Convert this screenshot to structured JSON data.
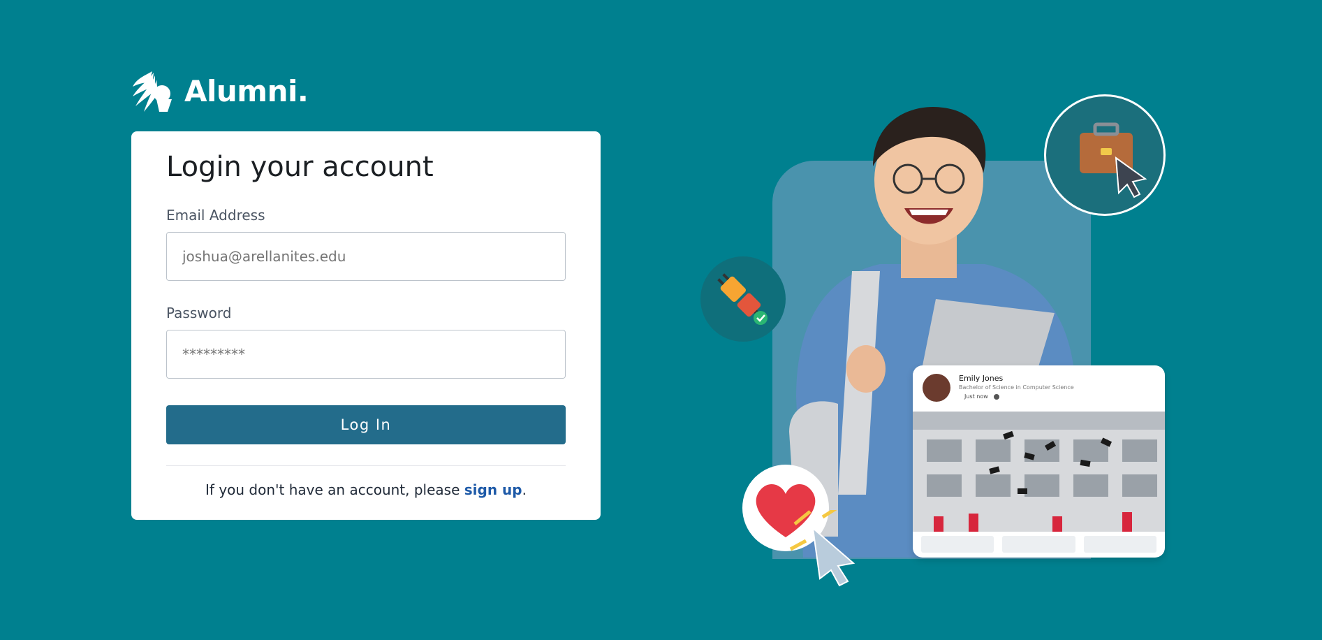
{
  "brand": {
    "name": "Alumni.",
    "logo_icon": "headdress-icon"
  },
  "login": {
    "title": "Login your account",
    "email_label": "Email Address",
    "email_placeholder": "joshua@arellanites.edu",
    "password_label": "Password",
    "password_placeholder": "*********",
    "submit_label": "Log In",
    "signup_prefix": "If you don't have an account, please ",
    "signup_link": "sign up",
    "signup_suffix": "."
  },
  "post": {
    "name": "Emily Jones",
    "degree": "Bachelor of Science in Computer Science",
    "time": "Just now"
  },
  "colors": {
    "background": "#00808f",
    "button": "#236c8b",
    "link": "#1e5aa8"
  },
  "icons": [
    "briefcase-icon",
    "cursor-icon",
    "plug-icon",
    "heart-icon",
    "globe-icon"
  ]
}
